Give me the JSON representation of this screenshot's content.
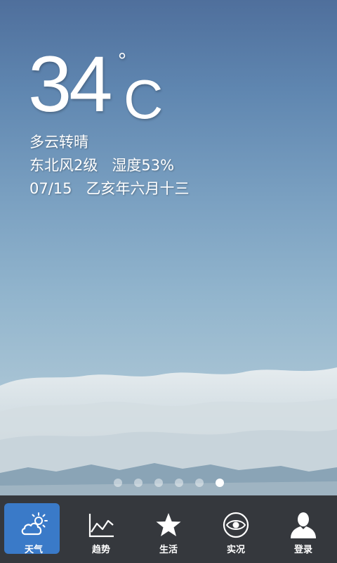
{
  "weather": {
    "temperature": "34",
    "degree_symbol": "°",
    "unit": "C",
    "condition": "多云转晴",
    "wind_humidity": "东北风2级   湿度53%",
    "date_lunar": "07/15   乙亥年六月十三"
  },
  "pager": {
    "count": 6,
    "active_index": 5
  },
  "tabs": [
    {
      "label": "天气",
      "icon": "cloud-sun-icon",
      "active": true
    },
    {
      "label": "趋势",
      "icon": "trend-chart-icon",
      "active": false
    },
    {
      "label": "生活",
      "icon": "star-icon",
      "active": false
    },
    {
      "label": "实况",
      "icon": "eye-icon",
      "active": false
    },
    {
      "label": "登录",
      "icon": "user-icon",
      "active": false
    }
  ],
  "colors": {
    "active_tab": "#3a7ac8",
    "tabbar": "#35383d"
  }
}
